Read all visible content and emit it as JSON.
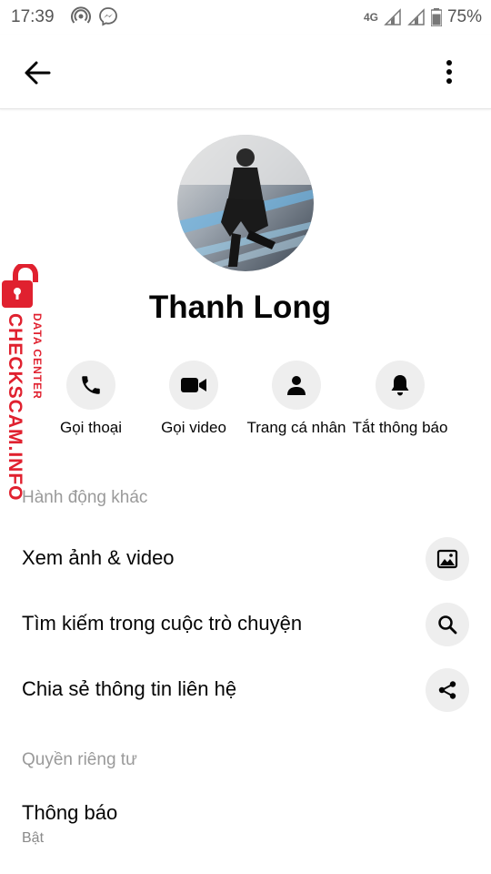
{
  "status_bar": {
    "time": "17:39",
    "network": "4G",
    "battery": "75%"
  },
  "app_bar": {
    "back_icon": "arrow-left-icon",
    "more_icon": "more-vertical-icon"
  },
  "profile": {
    "name": "Thanh Long"
  },
  "actions": [
    {
      "label": "Gọi thoại",
      "icon": "phone-icon"
    },
    {
      "label": "Gọi video",
      "icon": "video-camera-icon"
    },
    {
      "label": "Trang cá nhân",
      "icon": "person-icon"
    },
    {
      "label": "Tắt thông báo",
      "icon": "bell-icon"
    }
  ],
  "more_actions": {
    "header": "Hành động khác",
    "items": [
      {
        "label": "Xem ảnh & video",
        "icon": "image-icon"
      },
      {
        "label": "Tìm kiếm trong cuộc trò chuyện",
        "icon": "search-icon"
      },
      {
        "label": "Chia sẻ thông tin liên hệ",
        "icon": "share-icon"
      }
    ]
  },
  "privacy": {
    "header": "Quyền riêng tư",
    "items": [
      {
        "label": "Thông báo",
        "sublabel": "Bật"
      }
    ]
  },
  "watermark": {
    "main": "CHECKSCAM.INFO",
    "sub": "DATA CENTER"
  },
  "colors": {
    "icon_bg": "#eeeeee",
    "section_header": "#9a9a9a",
    "watermark": "#e0212f"
  }
}
